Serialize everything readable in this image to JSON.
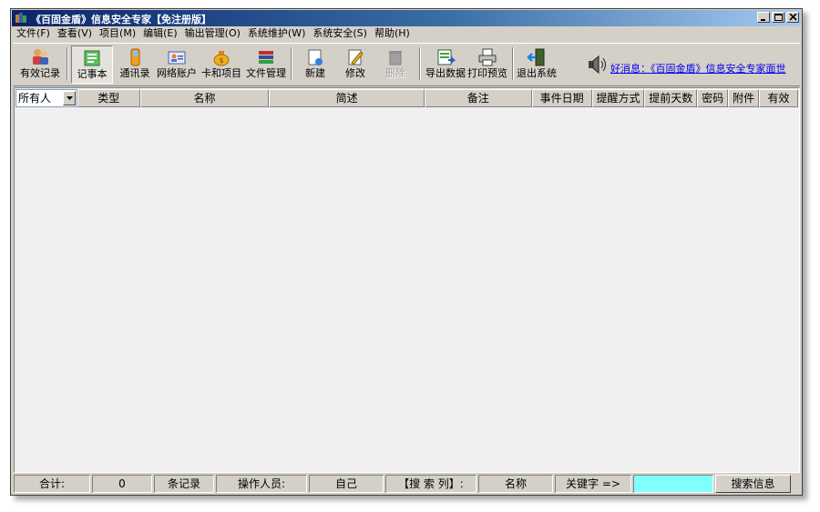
{
  "window": {
    "title": "《百固金盾》信息安全专家【免注册版】",
    "controls": {
      "minimize": "_",
      "maximize": "□",
      "close": "×"
    }
  },
  "menubar": [
    "文件(F)",
    "查看(V)",
    "项目(M)",
    "编辑(E)",
    "输出管理(O)",
    "系统维护(W)",
    "系统安全(S)",
    "帮助(H)"
  ],
  "toolbar": {
    "valid_records": "有效记录",
    "notebook": "记事本",
    "contacts": "通讯录",
    "web_accounts": "网络账户",
    "cards": "卡和项目",
    "file_mgmt": "文件管理",
    "new": "新建",
    "edit": "修改",
    "delete": "删除",
    "export": "导出数据",
    "print_preview": "打印预览",
    "exit": "退出系统"
  },
  "news": {
    "text": "好消息：《百固金盾》信息安全专家面世",
    "icon": "speaker-icon"
  },
  "grid": {
    "owner_filter": "所有人",
    "columns": [
      "类型",
      "名称",
      "简述",
      "备注",
      "事件日期",
      "提醒方式",
      "提前天数",
      "密码",
      "附件",
      "有效"
    ],
    "rows": []
  },
  "status": {
    "total_label": "合计:",
    "count": "0",
    "records_label": "条记录",
    "operator_label": "操作人员:",
    "operator": "自己",
    "search_col_label": "【搜 索 列】:",
    "search_col": "名称",
    "keyword_label": "关键字 =>",
    "keyword": "",
    "search_button": "搜索信息"
  },
  "colors": {
    "titlebar_start": "#0a246a",
    "titlebar_end": "#a6caf0",
    "face": "#d4d0c8",
    "keyword_input": "#80ffff",
    "link": "#0000ee"
  }
}
